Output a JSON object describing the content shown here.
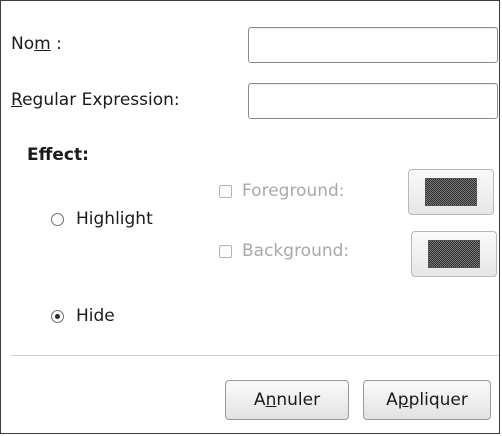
{
  "form": {
    "name_label_pre": "No",
    "name_label_mnemonic": "m",
    "name_label_post": " :",
    "name_value": "",
    "regex_label_mnemonic": "R",
    "regex_label_post": "egular Expression:",
    "regex_value": ""
  },
  "effect": {
    "title": "Effect:",
    "highlight": {
      "label": "Highlight",
      "selected": false
    },
    "foreground": {
      "label": "Foreground:",
      "checked": false,
      "enabled": false,
      "color_name": "dark-gray"
    },
    "background": {
      "label": "Background:",
      "checked": false,
      "enabled": false,
      "color_name": "dark-gray"
    },
    "hide": {
      "label": "Hide",
      "selected": true
    }
  },
  "buttons": {
    "cancel_pre": "A",
    "cancel_mnemonic": "n",
    "cancel_post": "nuler",
    "apply_pre": "A",
    "apply_mnemonic": "p",
    "apply_post": "pliquer"
  }
}
